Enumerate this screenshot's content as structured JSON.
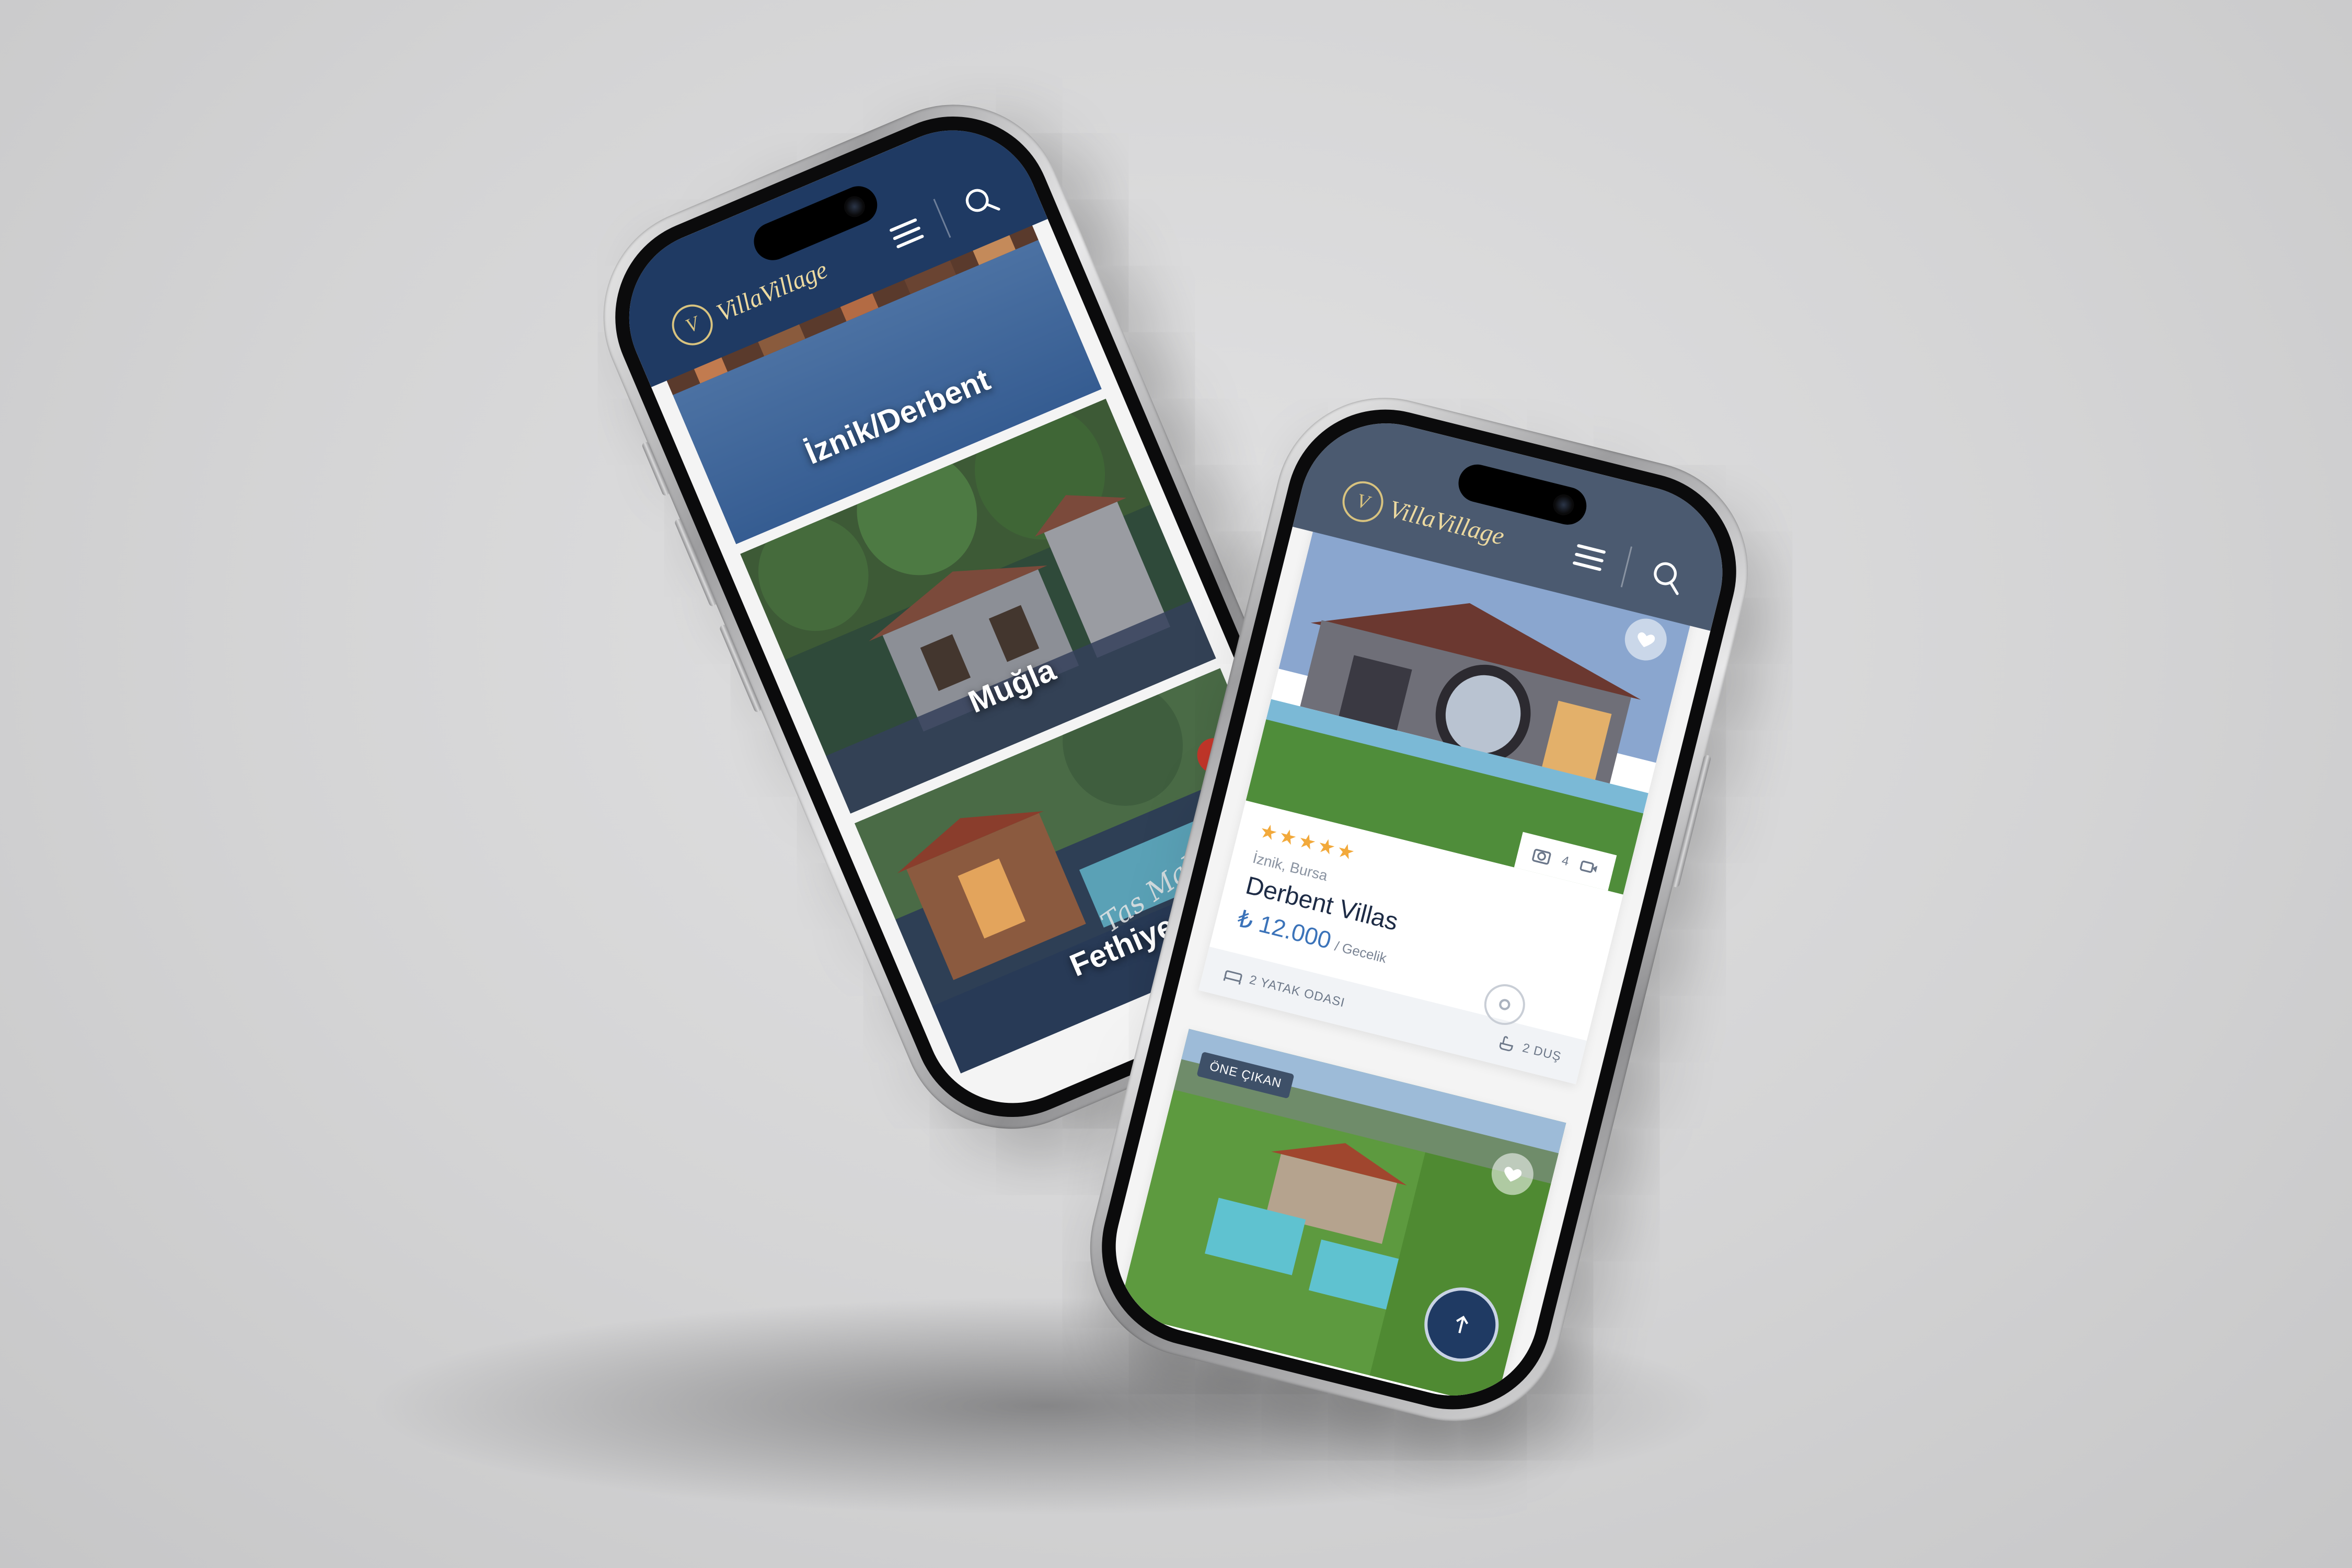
{
  "brand": {
    "logo_text": "VillaVillage",
    "logo_mark": "V"
  },
  "colors": {
    "header_navy": "#1f3a63",
    "header_slate": "#4b5a70",
    "accent_gold": "#d8c37f",
    "price_blue": "#3b73b9",
    "star": "#f2a93b"
  },
  "icons": {
    "menu": "hamburger-icon",
    "search": "search-icon",
    "heart": "heart-icon",
    "camera": "camera-icon",
    "video": "video-icon",
    "bed": "bed-icon",
    "shower": "shower-icon",
    "map": "map-pin-icon",
    "scroll_top": "arrow-up-icon"
  },
  "left_phone": {
    "destinations": [
      {
        "label": "İznik/Derbent"
      },
      {
        "label": "Muğla"
      },
      {
        "label": "Fethiye",
        "overlay_script": "Tas Mahal"
      }
    ]
  },
  "right_phone": {
    "listings": [
      {
        "stars": "★★★★★",
        "location": "İznik, Bursa",
        "title": "Derbent Villas",
        "price": "₺ 12.000",
        "price_unit": "/ Gecelik",
        "bedrooms": "2 YATAK ODASI",
        "showers": "2 DUŞ",
        "photo_count": "4"
      },
      {
        "badge": "ÖNE ÇIKAN",
        "stars": "★★★★★"
      }
    ]
  }
}
